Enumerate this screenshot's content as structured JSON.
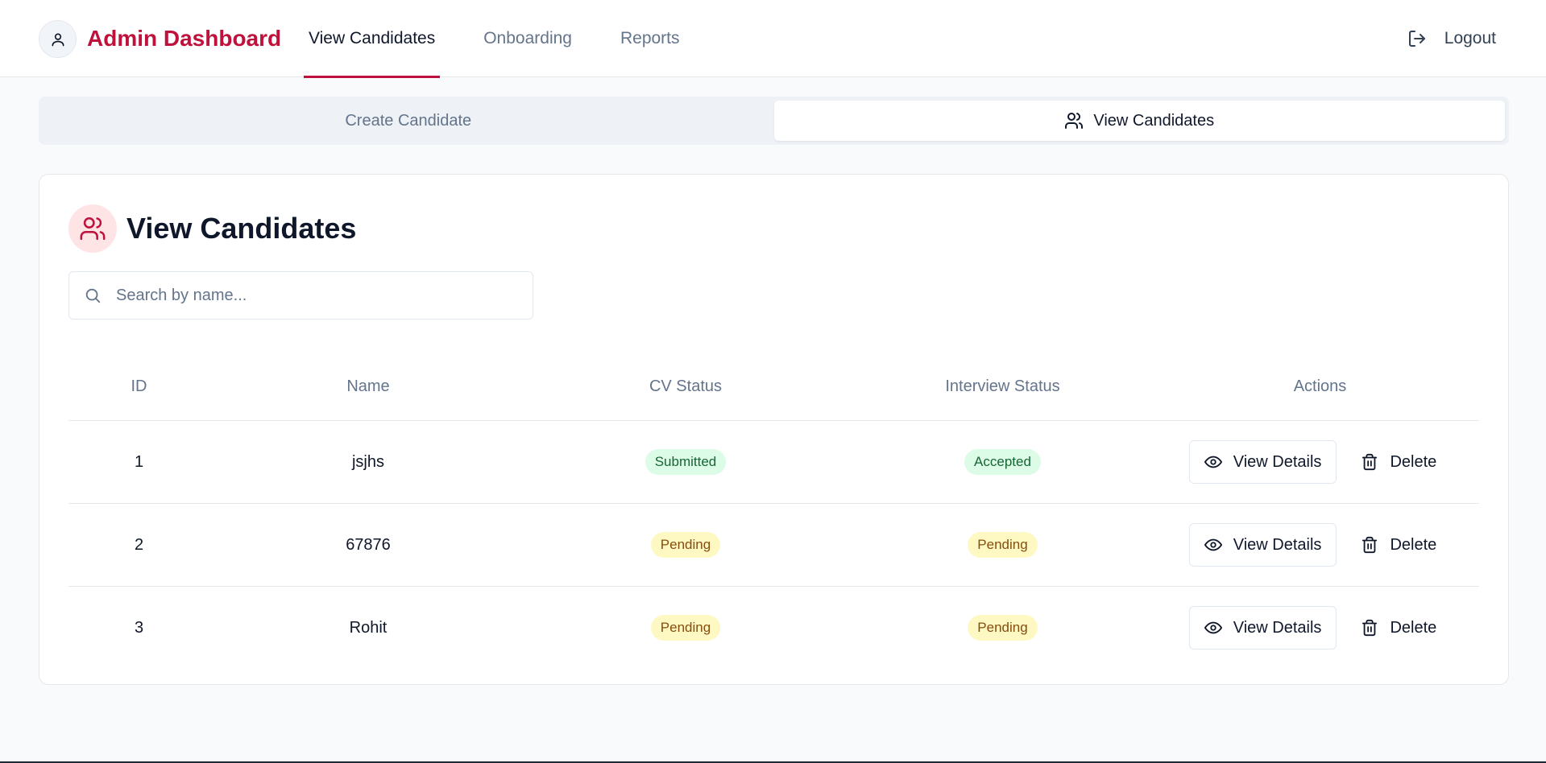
{
  "header": {
    "brand": "Admin Dashboard",
    "nav": [
      {
        "label": "View Candidates",
        "active": true
      },
      {
        "label": "Onboarding",
        "active": false
      },
      {
        "label": "Reports",
        "active": false
      }
    ],
    "logout_label": "Logout",
    "brand_color": "#be123c"
  },
  "subtabs": [
    {
      "label": "Create Candidate",
      "active": false
    },
    {
      "label": "View Candidates",
      "active": true,
      "icon": "users-icon"
    }
  ],
  "card": {
    "title": "View Candidates",
    "icon": "users-icon",
    "search_placeholder": "Search by name..."
  },
  "table": {
    "columns": [
      "ID",
      "Name",
      "CV Status",
      "Interview Status",
      "Actions"
    ],
    "rows": [
      {
        "id": "1",
        "name": "jsjhs",
        "cv_status": "Submitted",
        "interview_status": "Accepted"
      },
      {
        "id": "2",
        "name": "67876",
        "cv_status": "Pending",
        "interview_status": "Pending"
      },
      {
        "id": "3",
        "name": "Rohit",
        "cv_status": "Pending",
        "interview_status": "Pending"
      }
    ],
    "actions": {
      "view": "View Details",
      "delete": "Delete"
    }
  },
  "colors": {
    "accent": "#be123c",
    "submitted_bg": "#dcfce7",
    "accepted_bg": "#dcfce7",
    "pending_bg": "#fef9c3"
  }
}
